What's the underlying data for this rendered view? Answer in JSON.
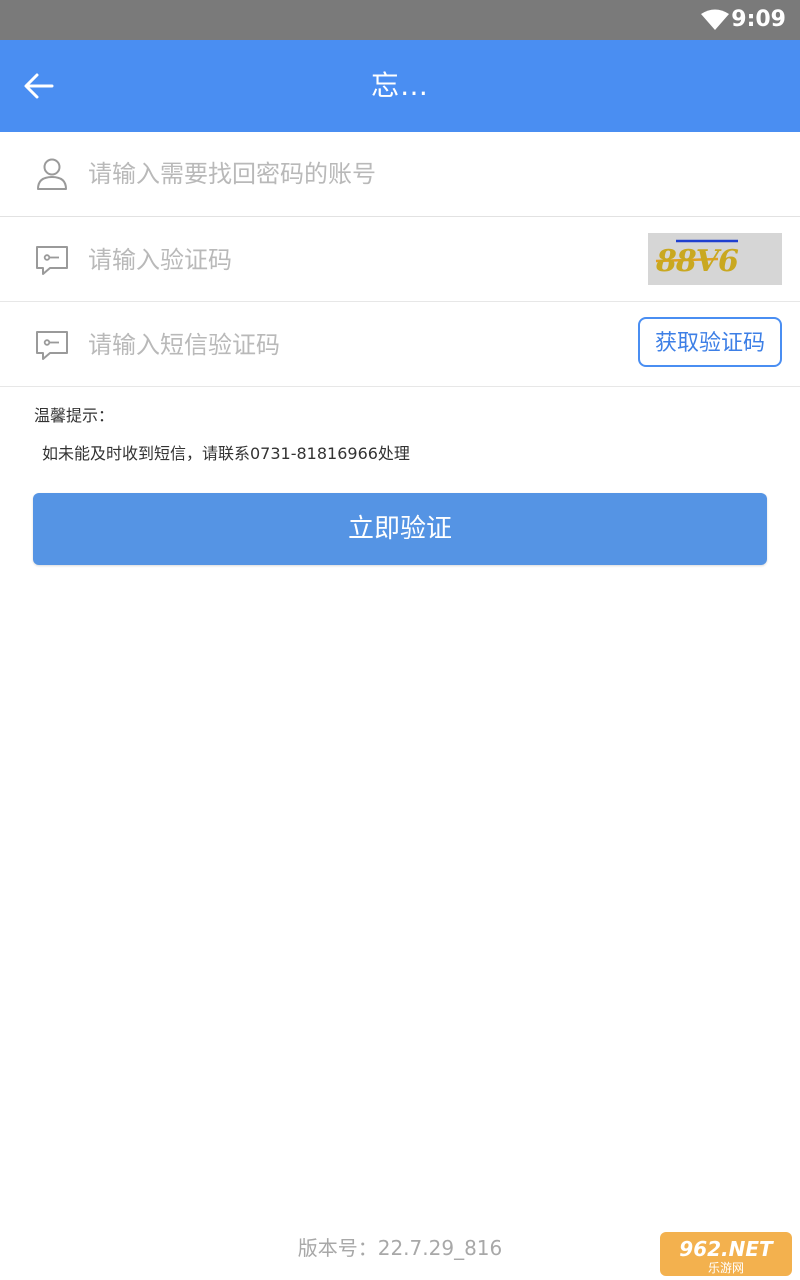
{
  "status_bar": {
    "time": "9:09"
  },
  "app_bar": {
    "title": "忘…",
    "icons": {
      "back": "arrow-left-icon"
    }
  },
  "form": {
    "account": {
      "placeholder": "请输入需要找回密码的账号",
      "icon": "user-icon"
    },
    "captcha": {
      "placeholder": "请输入验证码",
      "icon": "message-icon",
      "image_text": "88V6"
    },
    "sms": {
      "placeholder": "请输入短信验证码",
      "icon": "message-icon",
      "button_label": "获取验证码"
    }
  },
  "tips": {
    "title": "温馨提示：",
    "text": "如未能及时收到短信，请联系0731-81816966处理"
  },
  "verify_button": "立即验证",
  "version": "版本号：22.7.29_816",
  "watermark": {
    "text": "962.NET",
    "subtext": "乐游网"
  },
  "colors": {
    "primary": "#4a8ef2",
    "button": "#5594e4",
    "status_bar": "#7a7a7a"
  }
}
